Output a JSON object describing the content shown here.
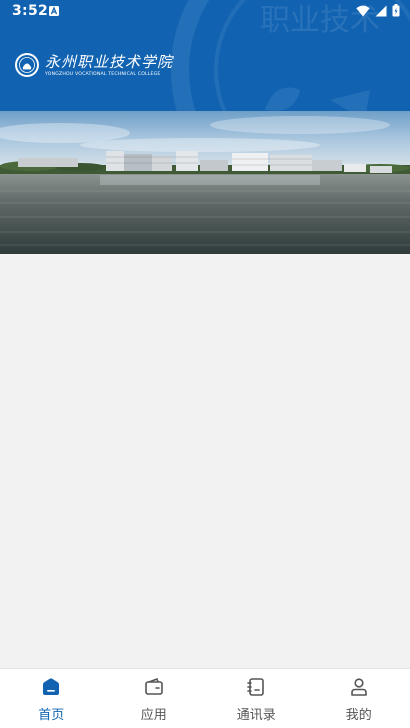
{
  "status_bar": {
    "time": "3:52",
    "icons": [
      "notification-icon",
      "wifi-icon",
      "signal-icon",
      "battery-icon"
    ]
  },
  "header": {
    "logo_cn": "永州职业技术学院",
    "logo_en": "YONGZHOU VOCATIONAL TECHNICAL COLLEGE",
    "watermark_text": "职业技术",
    "background_color": "#1163b2"
  },
  "banner": {
    "image": "campus-lake-panorama"
  },
  "bottom_nav": {
    "items": [
      {
        "label": "首页",
        "icon": "home-icon",
        "active": true
      },
      {
        "label": "应用",
        "icon": "wallet-icon",
        "active": false
      },
      {
        "label": "通讯录",
        "icon": "contacts-book-icon",
        "active": false
      },
      {
        "label": "我的",
        "icon": "user-icon",
        "active": false
      }
    ],
    "active_color": "#1163b2",
    "inactive_color": "#555555"
  }
}
